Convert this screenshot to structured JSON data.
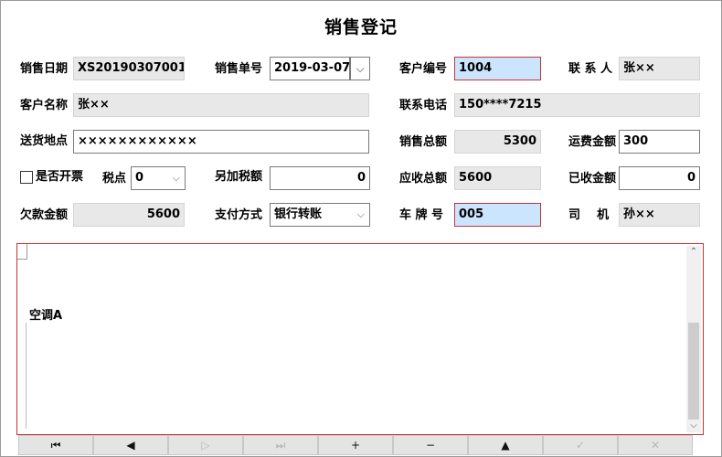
{
  "form": {
    "title": "销售登记",
    "labels": {
      "sale_date": "销售日期",
      "sale_no": "销售单号",
      "customer_no": "客户编号",
      "contact": "联 系 人",
      "customer_name": "客户名称",
      "phone": "联系电话",
      "address": "送货地点",
      "sales_total": "销售总额",
      "freight": "运费金额",
      "invoice": "是否开票",
      "tax_point": "税点",
      "extra_tax": "另加税额",
      "receivable": "应收总额",
      "received": "已收金额",
      "arrears": "欠款金额",
      "payment": "支付方式",
      "plate": "车 牌 号",
      "driver": "司    机"
    },
    "values": {
      "sale_date": "XS20190307001",
      "sale_no": "2019-03-07",
      "customer_no": "1004",
      "contact": "张××",
      "customer_name": "张××",
      "phone": "150****7215",
      "address": "××××××××××××",
      "sales_total": "5300",
      "freight": "300",
      "tax_point": "0",
      "extra_tax": "0",
      "receivable": "5600",
      "received": "0",
      "arrears": "5600",
      "payment": "银行转账",
      "plate": "005",
      "driver": "孙××"
    },
    "invoice_checked": false
  },
  "grid": {
    "cell_text": "空调A"
  },
  "icons": {
    "dropdown": "chevron-down",
    "nav": [
      "first",
      "prev",
      "next",
      "last",
      "add",
      "delete",
      "up",
      "confirm",
      "cancel"
    ]
  },
  "navigator": {
    "glyphs": [
      "⏮",
      "◀",
      "▷",
      "⏭",
      "+",
      "−",
      "▲",
      "✓",
      "✕"
    ],
    "enabled": [
      true,
      true,
      false,
      false,
      true,
      true,
      true,
      false,
      false
    ]
  },
  "colors": {
    "highlight_field": "#cce5ff",
    "highlight_border": "#cc3333",
    "readonly_field": "#e8e8e8"
  }
}
